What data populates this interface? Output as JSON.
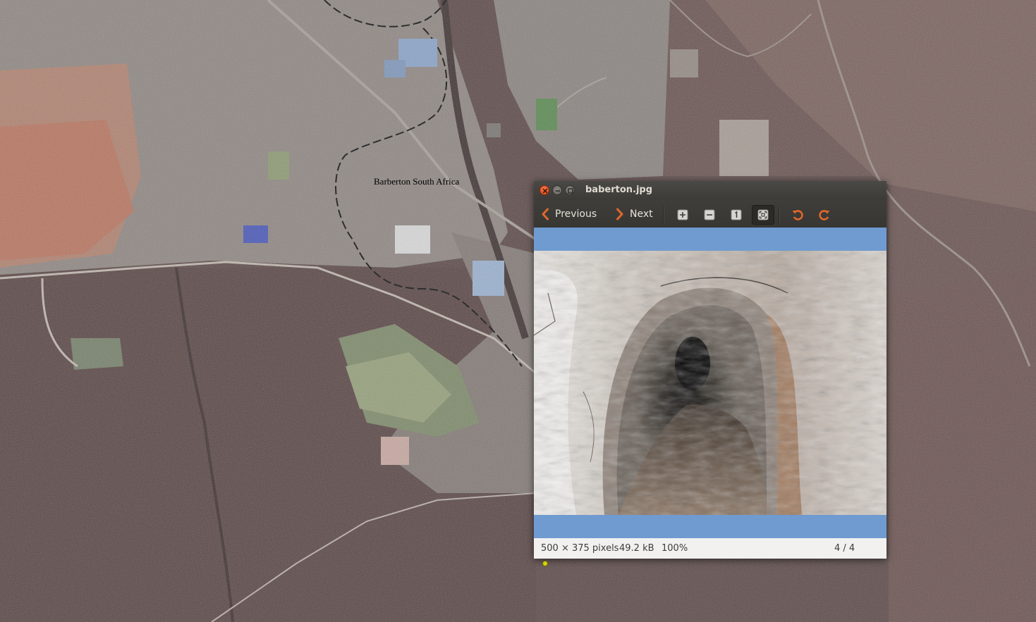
{
  "map": {
    "label": "Barberton South Africa"
  },
  "window": {
    "title": "baberton.jpg"
  },
  "toolbar": {
    "previous_label": "Previous",
    "next_label": "Next",
    "icons": {
      "zoom_in": "zoom-in-icon",
      "zoom_out": "zoom-out-icon",
      "normal_size": "normal-size-icon",
      "best_fit": "best-fit-icon",
      "rotate_left": "rotate-left-icon",
      "rotate_right": "rotate-right-icon"
    },
    "best_fit_active": true
  },
  "status": {
    "dimensions": "500 × 375 pixels",
    "file_size": "49.2 kB",
    "zoom": "100%",
    "position": "4 / 4"
  },
  "colors": {
    "image_background": "#6f9bd0",
    "accent_orange": "#e0682b",
    "close_button": "#e2561e"
  }
}
